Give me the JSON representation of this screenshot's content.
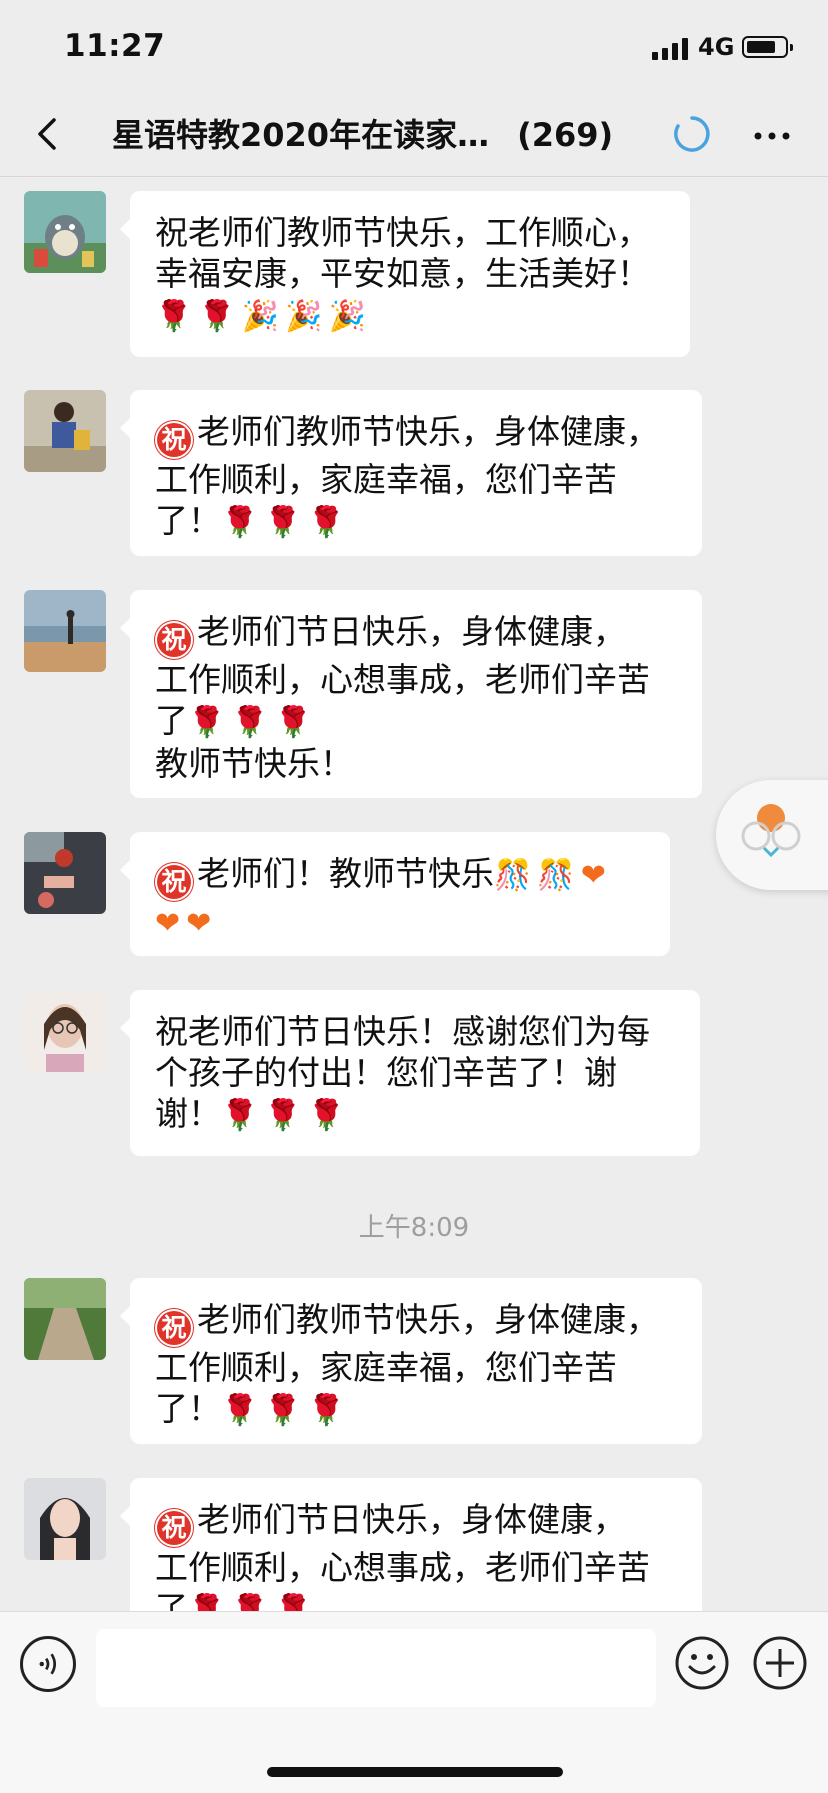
{
  "status_bar": {
    "time": "11:27",
    "network": "4G",
    "battery_level": 0.7
  },
  "header": {
    "title": "星语特教2020年在读家…",
    "member_count": "(269)"
  },
  "messages": [
    {
      "avatar": "totoro-avatar",
      "lines": [
        "祝老师们教师节快乐，工作顺心，",
        "幸福安康，平安如意，生活美好！"
      ],
      "emoji_line": [
        "rose",
        "rose",
        "party",
        "party",
        "party"
      ]
    },
    {
      "avatar": "child-photo-avatar",
      "zhu": "祝",
      "lines": [
        "老师们教师节快乐，身体健康，",
        "工作顺利，家庭幸福，您们辛苦",
        "了！"
      ],
      "emoji_tail": [
        "rose",
        "rose",
        "rose"
      ]
    },
    {
      "avatar": "beach-photo-avatar",
      "zhu": "祝",
      "lines": [
        "老师们节日快乐，身体健康，",
        "工作顺利，心想事成，老师们辛苦",
        "了"
      ],
      "emoji_tail": [
        "rose",
        "rose",
        "rose"
      ],
      "extra_line": "教师节快乐！"
    },
    {
      "avatar": "hands-photo-avatar",
      "zhu": "祝",
      "lines": [
        "老师们！教师节快乐"
      ],
      "emoji_tail": [
        "ribbon",
        "ribbon",
        "heart"
      ],
      "emoji_line": [
        "heart",
        "heart"
      ]
    },
    {
      "avatar": "woman-glasses-avatar",
      "lines": [
        "祝老师们节日快乐！感谢您们为每",
        "个孩子的付出！您们辛苦了！谢",
        "谢！"
      ],
      "emoji_tail": [
        "rose",
        "rose",
        "rose"
      ]
    },
    {
      "avatar": "path-photo-avatar",
      "zhu": "祝",
      "lines": [
        "老师们教师节快乐，身体健康，",
        "工作顺利，家庭幸福，您们辛苦",
        "了！"
      ],
      "emoji_tail": [
        "rose",
        "rose",
        "rose"
      ]
    },
    {
      "avatar": "woman-portrait-avatar",
      "zhu": "祝",
      "lines": [
        "老师们节日快乐，身体健康，",
        "工作顺利，心想事成，老师们辛苦",
        "了"
      ],
      "emoji_tail": [
        "rose",
        "rose",
        "rose"
      ]
    }
  ],
  "timestamp": "上午8:09",
  "emoji_glyphs": {
    "rose": "🌹",
    "party": "🎉",
    "heart": "❤",
    "ribbon": "🎊"
  },
  "input": {
    "placeholder": ""
  },
  "colors": {
    "background": "#ededed",
    "bubble": "#ffffff",
    "zhu_badge": "#e0332a",
    "spinner": "#4aa3df"
  }
}
